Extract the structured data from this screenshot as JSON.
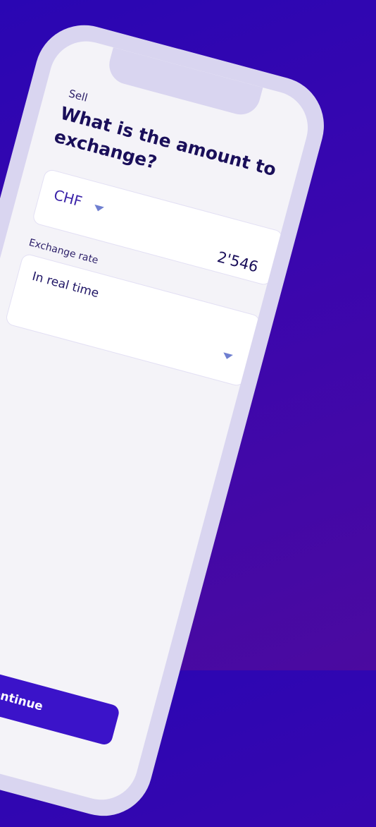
{
  "screen": {
    "step_label": "Sell",
    "title": "What is the amount to exchange?"
  },
  "amount": {
    "currency": "CHF",
    "value": "2'546"
  },
  "exchange_rate": {
    "label": "Exchange rate",
    "selected": "In real time"
  },
  "actions": {
    "continue_label": "Continue"
  }
}
